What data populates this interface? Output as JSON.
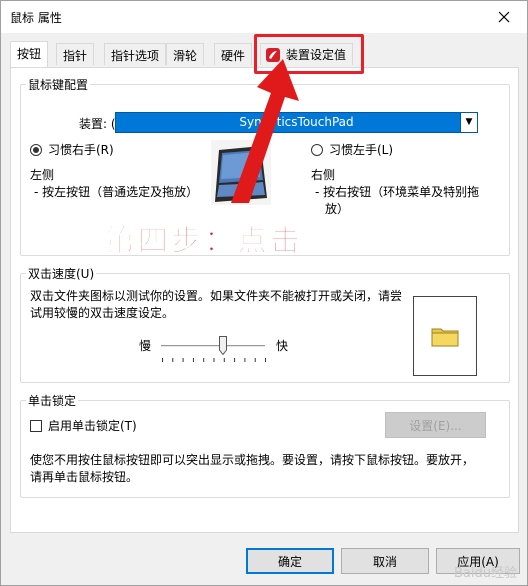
{
  "window": {
    "title": "鼠标 属性"
  },
  "tabs": [
    {
      "label": "按钮",
      "active": true
    },
    {
      "label": "指针",
      "active": false
    },
    {
      "label": "指针选项",
      "active": false
    },
    {
      "label": "滑轮",
      "active": false
    },
    {
      "label": "硬件",
      "active": false
    },
    {
      "label": "装置设定值",
      "active": false,
      "icon": "device-settings-icon"
    }
  ],
  "button_config": {
    "group_title": "鼠标键配置",
    "device_label": "装置: (V)",
    "device_value": "SynapticsTouchPad",
    "right_hand": "习惯右手(R)",
    "left_hand": "习惯左手(L)",
    "left_side_title": "左侧",
    "left_side_desc": "- 按左按钮（普通选定及拖放）",
    "right_side_title": "右侧",
    "right_side_desc_1": "- 按右按钮（环境菜单及特别拖",
    "right_side_desc_2": "放）"
  },
  "double_click": {
    "group_title": "双击速度(U)",
    "desc_1": "双击文件夹图标以测试你的设置。如果文件夹不能被打开或关闭，请尝",
    "desc_2": "试用较慢的双击速度设定。",
    "slow_label": "慢",
    "fast_label": "快",
    "speed_fraction": 0.6
  },
  "click_lock": {
    "group_title": "单击锁定",
    "checkbox_label": "启用单击锁定(T)",
    "settings_button": "设置(E)...",
    "desc_1": "使您不用按住鼠标按钮即可以突出显示或拖拽。要设置，请按下鼠标按钮。要放开，",
    "desc_2": "请再单击鼠标按钮。"
  },
  "footer": {
    "ok": "确定",
    "cancel": "取消",
    "apply": "应用(A)"
  },
  "annotation": {
    "text": "第四步：点击"
  },
  "watermark": "Baidu经验",
  "colors": {
    "accent": "#0078d7",
    "annotation_red": "#e01a1a"
  }
}
